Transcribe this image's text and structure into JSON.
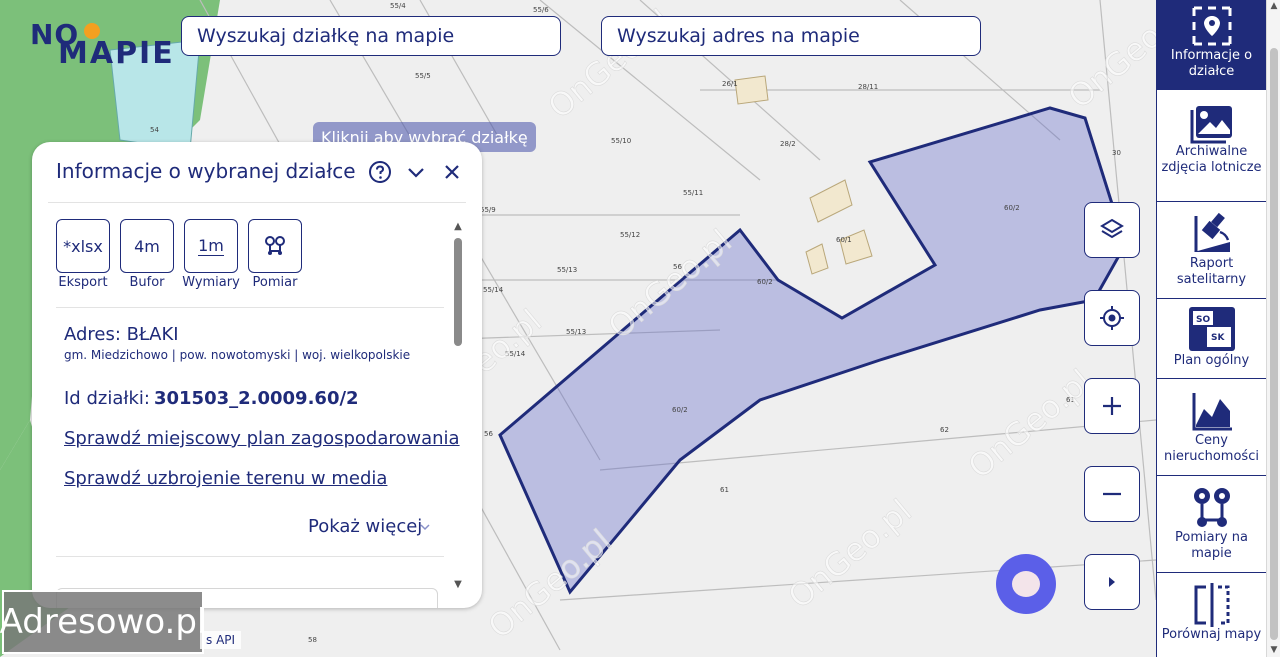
{
  "logo": {
    "line1": "NO",
    "line2": "MAPIE"
  },
  "search": {
    "parcel_placeholder": "Wyszukaj działkę na mapie",
    "address_placeholder": "Wyszukaj adres na mapie"
  },
  "map": {
    "tooltip": "Kliknij aby wybrać działkę",
    "watermark": "Adresowo.pl",
    "attribution": "s API",
    "parcel_labels": [
      "55/4",
      "55/6",
      "55/5",
      "26/1",
      "28/11",
      "55/10",
      "28/2",
      "30",
      "55/9",
      "55/11",
      "54",
      "60/1",
      "55/12",
      "55/13",
      "56",
      "60/2",
      "55/14",
      "55/13",
      "55/14",
      "60/2",
      "62",
      "61",
      "61",
      "58"
    ],
    "watermark_text": "OnGeo.pl"
  },
  "panel": {
    "title": "Informacje o wybranej działce",
    "tools": [
      {
        "label": "*xlsx",
        "caption": "Eksport"
      },
      {
        "label": "4m",
        "caption": "Bufor"
      },
      {
        "label": "1m",
        "caption": "Wymiary"
      },
      {
        "label": "",
        "caption": "Pomiar"
      }
    ],
    "address": "Adres: BŁAKI",
    "region": "gm. Miedzichowo | pow. nowotomyski | woj. wielkopolskie",
    "parcel_id_label": "Id działki:",
    "parcel_id_value": "301503_2.0009.60/2",
    "links": [
      "Sprawdź miejscowy plan zagospodarowania",
      "Sprawdź uzbrojenie terenu w media"
    ],
    "show_more": "Pokaż więcej"
  },
  "sidebar": {
    "items": [
      {
        "label": "Informacje o działce",
        "icon": "parcel-info-icon",
        "active": true
      },
      {
        "label": "Archiwalne zdjęcia lotnicze",
        "icon": "aerial-photo-icon",
        "active": false
      },
      {
        "label": "Raport satelitarny",
        "icon": "satellite-icon",
        "active": false
      },
      {
        "label": "Plan ogólny",
        "icon": "general-plan-icon",
        "active": false
      },
      {
        "label": "Ceny nieruchomości",
        "icon": "price-chart-icon",
        "active": false
      },
      {
        "label": "Pomiary na mapie",
        "icon": "measure-icon",
        "active": false
      },
      {
        "label": "Porównaj mapy",
        "icon": "compare-maps-icon",
        "active": false
      }
    ]
  },
  "colors": {
    "brand": "#1f2b7a",
    "parcel_fill": "#5b63c8",
    "chat": "#5b5fe8"
  }
}
